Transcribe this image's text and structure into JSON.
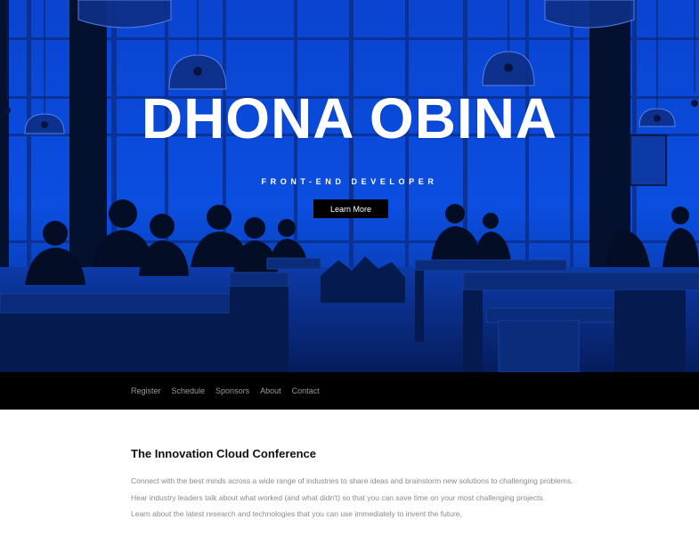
{
  "hero": {
    "title": "DHONA OBINA",
    "subtitle": "FRONT-END DEVELOPER",
    "button_label": "Learn More",
    "overlay_color": "#0a48d6"
  },
  "nav": {
    "items": [
      {
        "label": "Register"
      },
      {
        "label": "Schedule"
      },
      {
        "label": "Sponsors"
      },
      {
        "label": "About"
      },
      {
        "label": "Contact"
      }
    ]
  },
  "content": {
    "title": "The Innovation Cloud Conference",
    "lines": [
      "Connect with the best minds across a wide range of industries to share ideas and brainstorm new solutions to challenging problems.",
      "Hear industry leaders talk about what worked (and what didn't) so that you can save time on your most challenging projects.",
      "Learn about the latest research and technologies that you can use immediately to invent the future."
    ]
  }
}
